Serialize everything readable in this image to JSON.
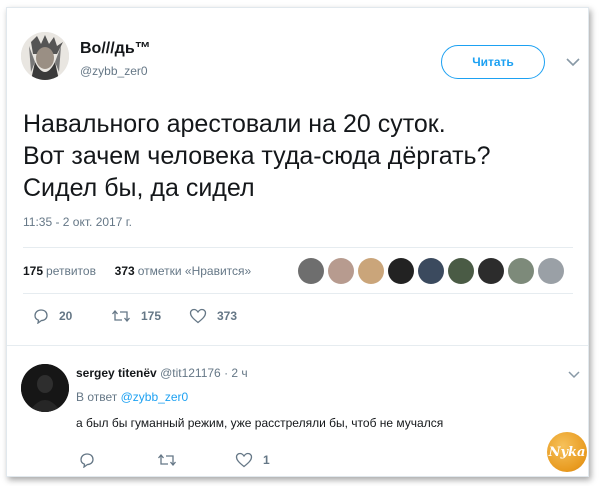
{
  "tweet": {
    "author_name": "Bo///дь™",
    "author_handle": "@zybb_zer0",
    "follow_label": "Читать",
    "text_lines": [
      "Навального арестовали на 20 суток.",
      "Вот зачем человека туда-сюда дёргать?",
      "Сидел бы, да сидел"
    ],
    "timestamp": "11:35 - 2 окт. 2017 г.",
    "stats": {
      "retweets_count": "175",
      "retweets_label": "ретвитов",
      "likes_count": "373",
      "likes_label": "отметки «Нравится»"
    },
    "actions": {
      "reply_count": "20",
      "retweet_count": "175",
      "like_count": "373"
    }
  },
  "reply": {
    "author_name": "sergey titenёv",
    "author_handle": "@tit121176",
    "time": "· 2 ч",
    "reply_to_prefix": "В ответ",
    "reply_to_handle": "@zybb_zer0",
    "text": "а был бы гуманный режим, уже расстреляли бы, чтоб не мучался",
    "actions": {
      "like_count": "1"
    }
  },
  "watermark": {
    "text": "Nyka"
  },
  "colors": {
    "accent": "#1da1f2",
    "secondary_text": "#657786",
    "primary_text": "#14171a",
    "divider": "#e6ecf0"
  }
}
